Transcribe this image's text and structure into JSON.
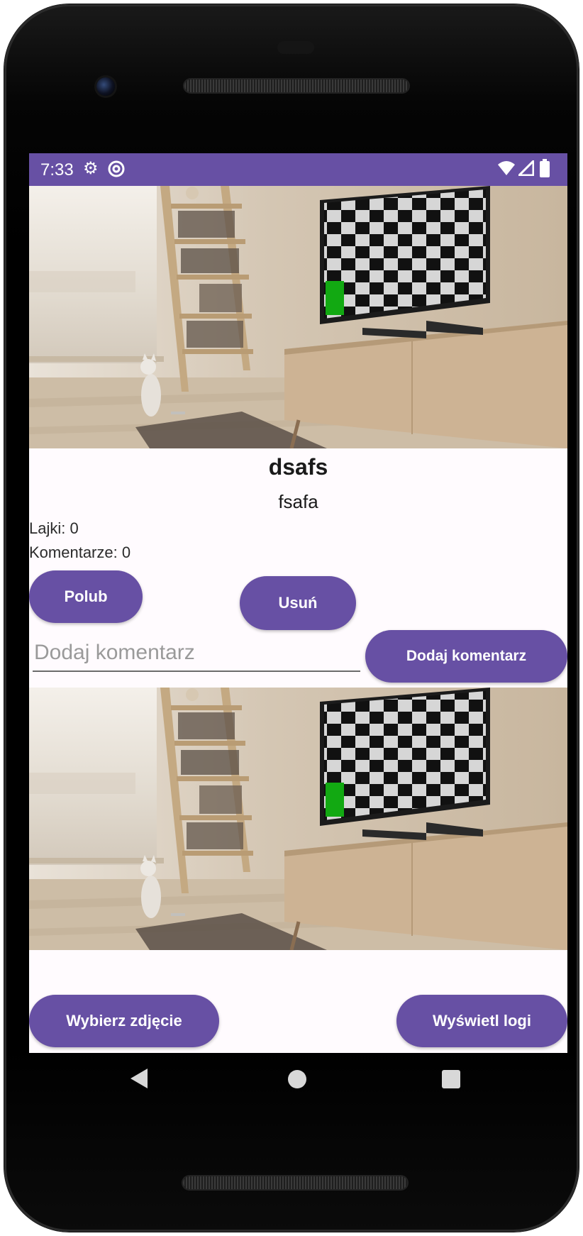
{
  "status_bar": {
    "time": "7:33",
    "left_icons": [
      "gear-icon",
      "sync-icon"
    ],
    "right_icons": [
      "wifi-icon",
      "signal-icon",
      "battery-icon"
    ],
    "color": "#6750a4"
  },
  "post": {
    "title": "dsafs",
    "description": "fsafa",
    "likes_label": "Lajki: 0",
    "comments_label": "Komentarze: 0",
    "like_button": "Polub",
    "delete_button": "Usuń",
    "comment_placeholder": "Dodaj komentarz",
    "comment_value": "",
    "add_comment_button": "Dodaj komentarz"
  },
  "footer": {
    "choose_photo_button": "Wybierz zdjęcie",
    "show_logs_button": "Wyświetl logi"
  },
  "nav": {
    "icons": [
      "back-icon",
      "home-icon",
      "recents-icon"
    ]
  },
  "theme": {
    "accent": "#6750a4",
    "background": "#fffbfe"
  }
}
